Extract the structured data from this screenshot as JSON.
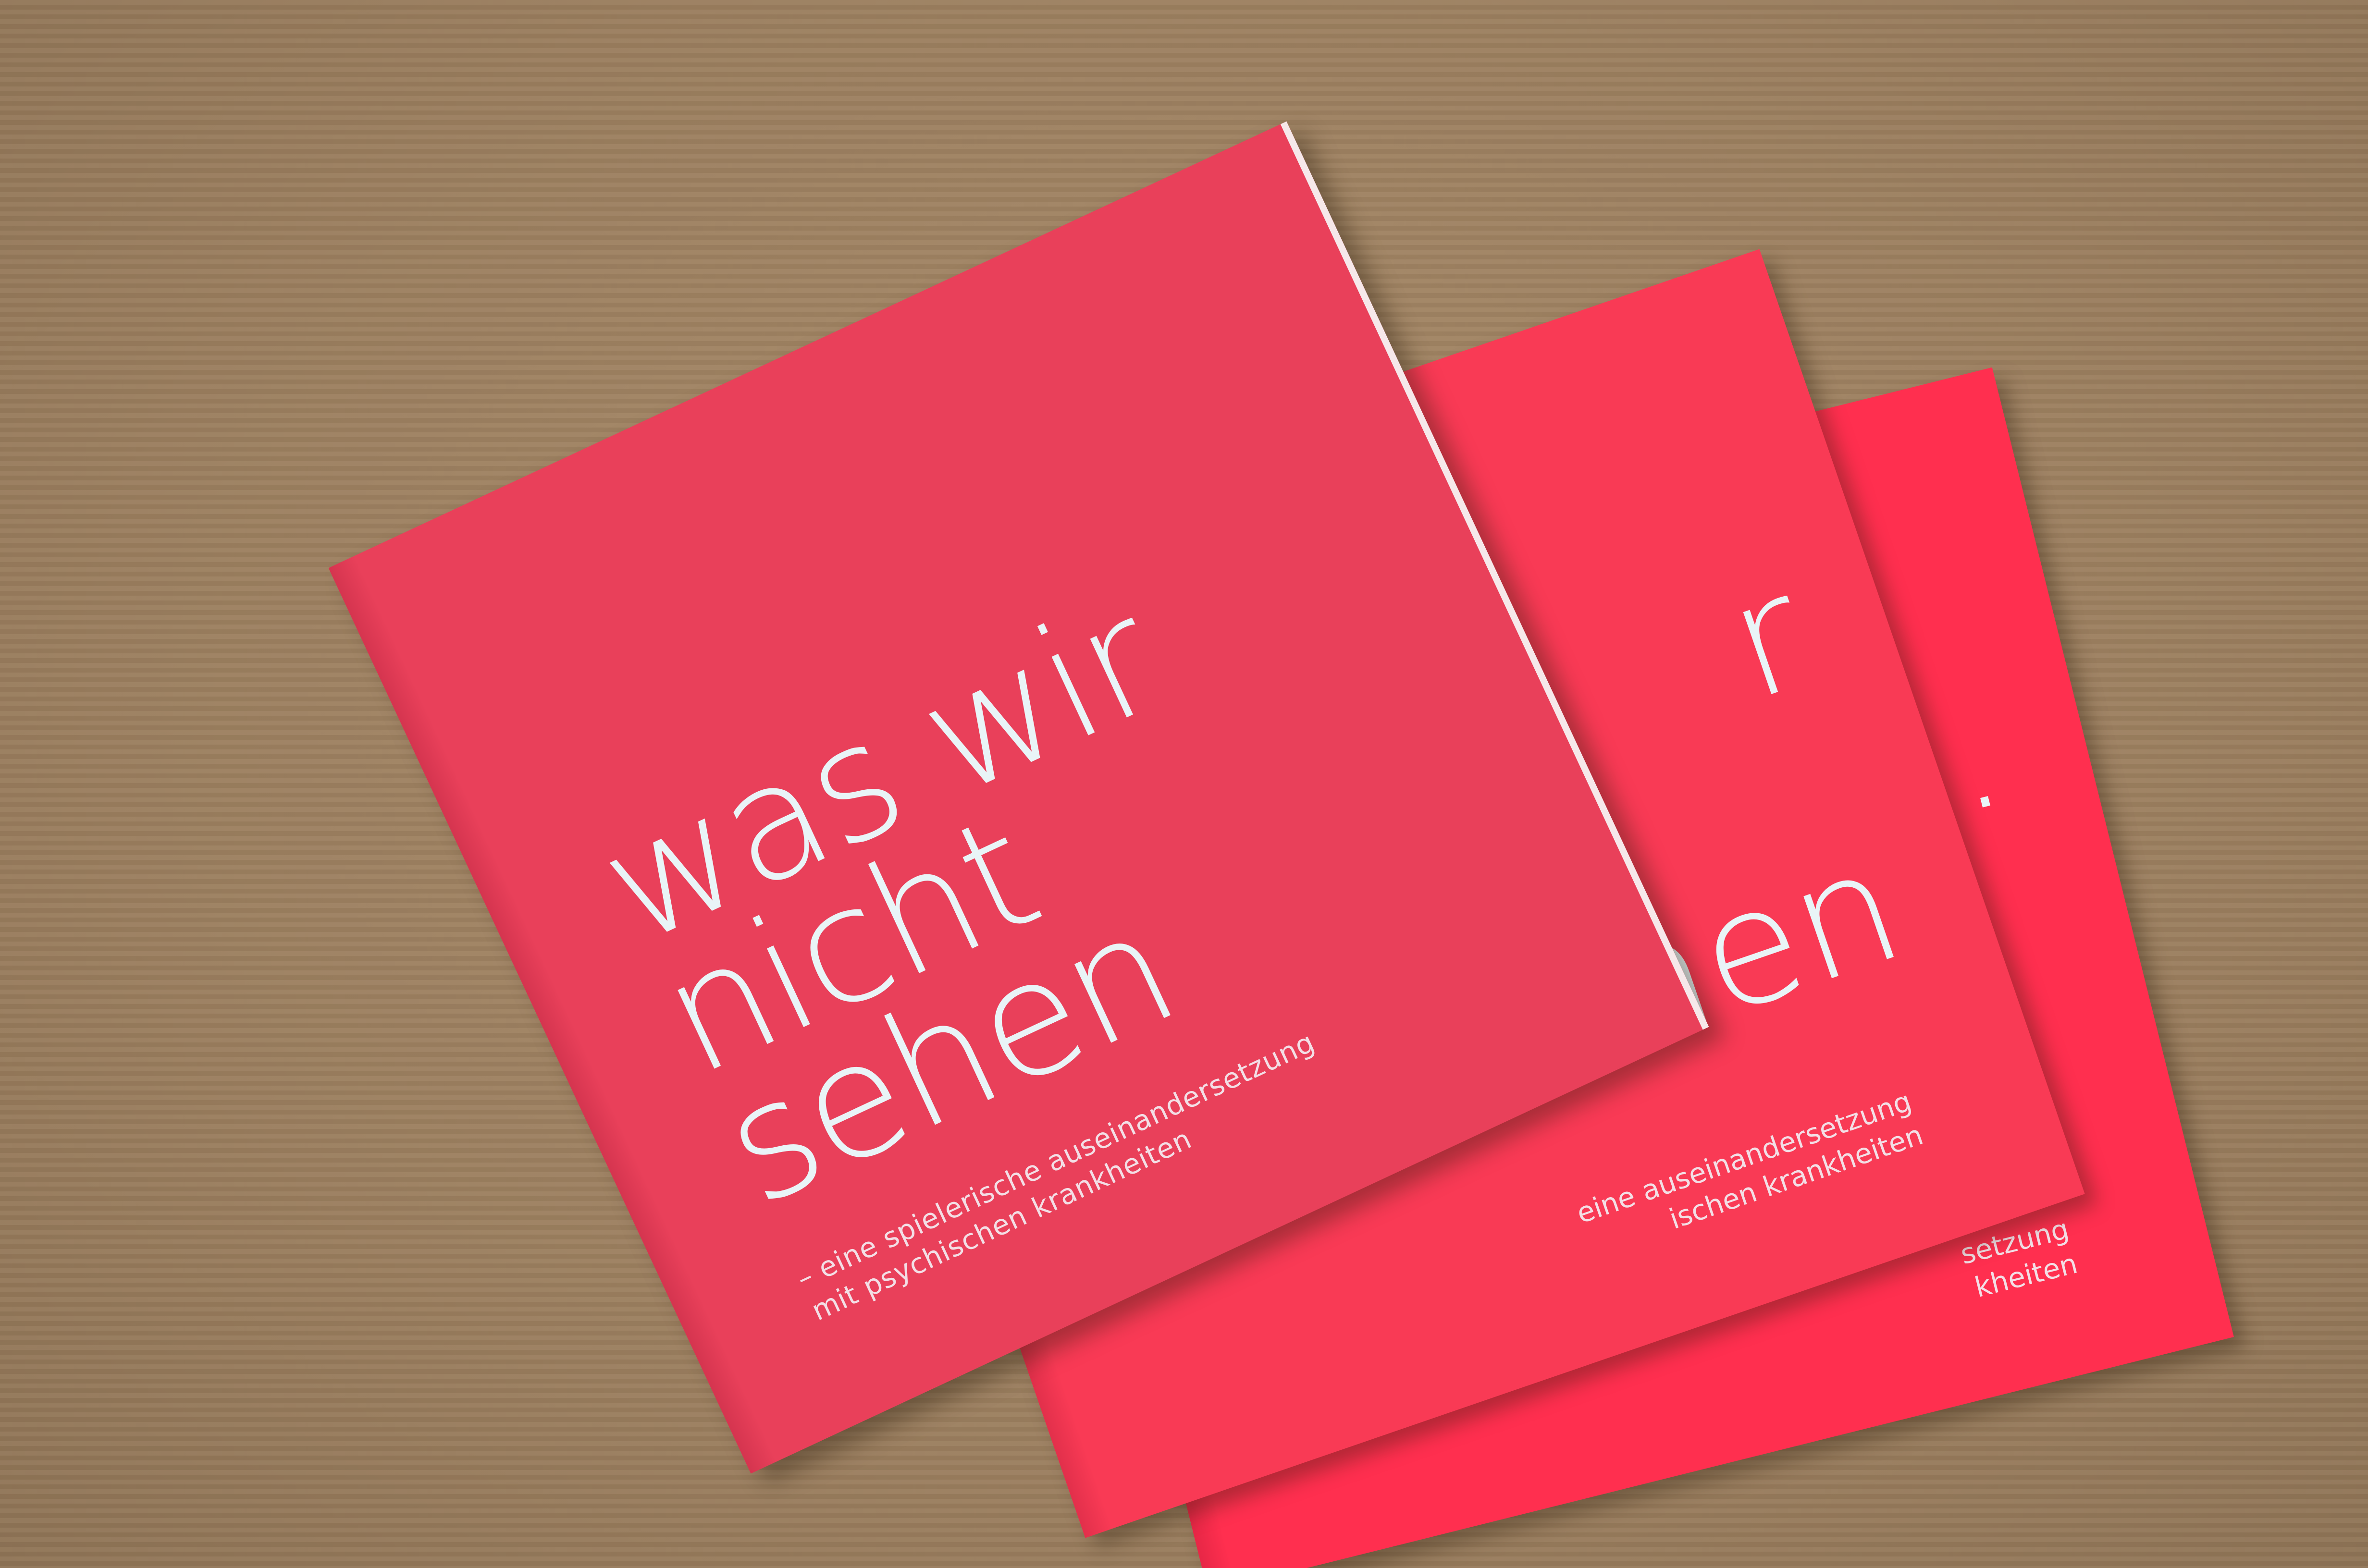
{
  "cover": {
    "title_lines": [
      "was wir",
      "nicht",
      "sehen"
    ],
    "subtitle_lines": [
      "– eine spielerische auseinandersetzung",
      "mit psychischen krankheiten"
    ]
  },
  "peek": {
    "middle_title_fragment": "r",
    "middle_title_lower": "hen",
    "middle_subtitle_1": "eine auseinandersetzung",
    "middle_subtitle_2": "ischen krankheiten",
    "back_title_fragment": ".",
    "back_subtitle_1": "setzung",
    "back_subtitle_2": "kheiten"
  },
  "colors": {
    "background": "#9c7f5f",
    "cover_red": "#e9405a",
    "cover_red_bright": "#ff2f4f",
    "text_white": "#e9f4f7"
  }
}
